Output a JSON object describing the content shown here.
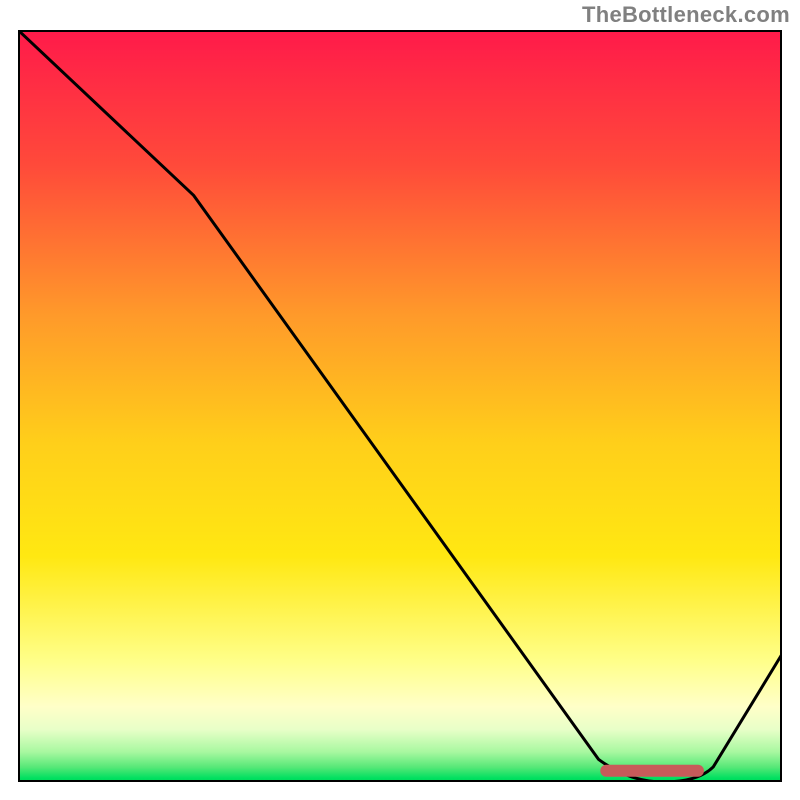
{
  "watermark": "TheBottleneck.com",
  "chart_data": {
    "type": "line",
    "title": "",
    "xlabel": "",
    "ylabel": "",
    "xlim": [
      0,
      100
    ],
    "ylim": [
      0,
      100
    ],
    "grid": false,
    "legend": false,
    "x": [
      0,
      23,
      80,
      89,
      100
    ],
    "values": [
      100,
      78,
      0,
      0,
      17
    ],
    "optimum_band": {
      "x_start": 77,
      "x_end": 89,
      "y": 1.5
    }
  },
  "colors": {
    "top": "#ff1a4a",
    "mid_upper": "#ff8a2a",
    "mid": "#ffe012",
    "mid_lower": "#ffff9a",
    "green_pale": "#c8ffb4",
    "green": "#00e060",
    "marker": "#c85a5a",
    "border": "#000000",
    "watermark": "#808080"
  }
}
